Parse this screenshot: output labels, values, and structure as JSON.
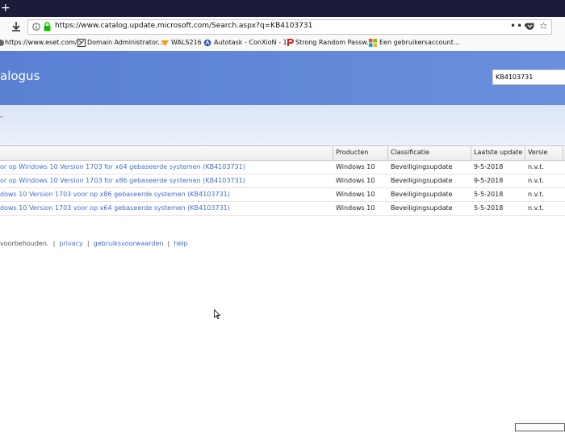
{
  "browser": {
    "new_tab": "+",
    "url": "https://www.catalog.update.microsoft.com/Search.aspx?q=KB4103731",
    "menu_dots": "•••",
    "star": "☆",
    "bookmarks": [
      {
        "label": "https://www.eset.com/...",
        "icon": "eset-icon"
      },
      {
        "label": "Domain Administrator...",
        "icon": "domain-icon"
      },
      {
        "label": "WALS216",
        "icon": "wals-icon"
      },
      {
        "label": "Autotask - ConXioN - 1",
        "icon": "autotask-icon"
      },
      {
        "label": "Strong Random Passw...",
        "icon": "password-icon"
      },
      {
        "label": "Een gebruikersaccount...",
        "icon": "microsoft-icon"
      }
    ]
  },
  "banner": {
    "title": "alogus",
    "search_value": "KB4103731"
  },
  "subheader": {
    "dash": "-"
  },
  "table": {
    "headers": [
      "Producten",
      "Classificatie",
      "Laatste update",
      "Versie"
    ],
    "rows": [
      {
        "title": "or op Windows 10 Version 1703 for x64 gebaseerde systemen (KB4103731)",
        "product": "Windows 10",
        "classification": "Beveiligingsupdate",
        "updated": "9-5-2018",
        "version": "n.v.t."
      },
      {
        "title": "or op Windows 10 Version 1703 for x86 gebaseerde systemen (KB4103731)",
        "product": "Windows 10",
        "classification": "Beveiligingsupdate",
        "updated": "9-5-2018",
        "version": "n.v.t."
      },
      {
        "title": "dows 10 Version 1703 voor op x86 gebaseerde systemen (KB4103731)",
        "product": "Windows 10",
        "classification": "Beveiligingsupdate",
        "updated": "5-5-2018",
        "version": "n.v.t."
      },
      {
        "title": "dows 10 Version 1703 voor op x64 gebaseerde systemen (KB4103731)",
        "product": "Windows 10",
        "classification": "Beveiligingsupdate",
        "updated": "5-5-2018",
        "version": "n.v.t."
      }
    ]
  },
  "footer": {
    "rights": "voorbehouden.",
    "sep": "|",
    "privacy": "privacy",
    "terms": "gebruiksvoorwaarden",
    "help": "help"
  },
  "colors": {
    "banner": "#5a80d4",
    "link": "#3c6fd0",
    "tabstrip": "#1c1b3a"
  }
}
